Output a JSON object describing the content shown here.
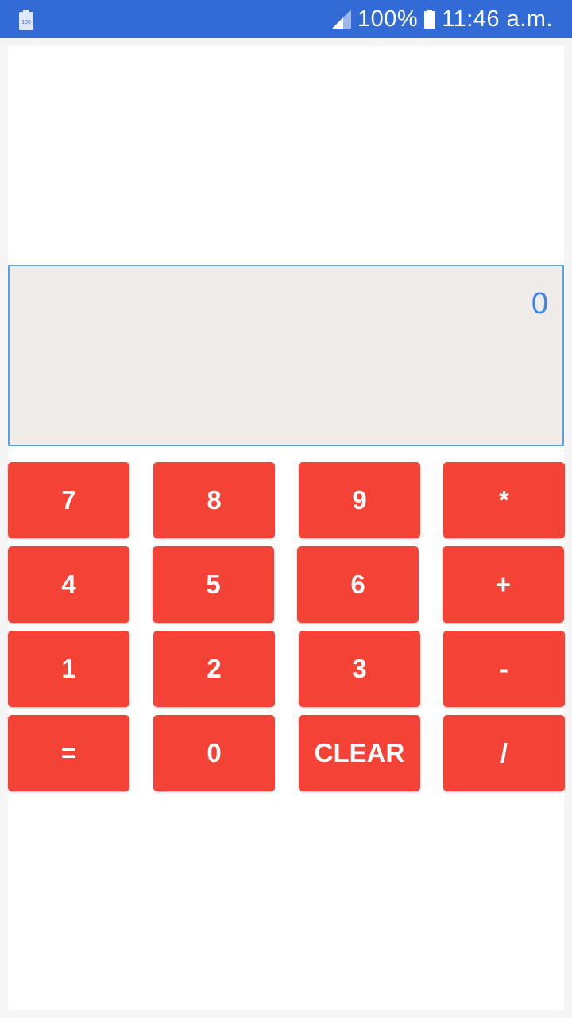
{
  "status_bar": {
    "battery_icon_label": "100",
    "battery_percent": "100%",
    "time": "11:46 a.m."
  },
  "display": {
    "value": "0"
  },
  "keypad": {
    "rows": [
      [
        "7",
        "8",
        "9",
        "*"
      ],
      [
        "4",
        "5",
        "6",
        "+"
      ],
      [
        "1",
        "2",
        "3",
        "-"
      ],
      [
        "=",
        "0",
        "CLEAR",
        "/"
      ]
    ]
  },
  "colors": {
    "status_bar": "#336bd6",
    "key": "#f44336",
    "display_bg": "#efebe9",
    "display_text": "#3f86e6",
    "display_border": "#5aa5e0"
  }
}
